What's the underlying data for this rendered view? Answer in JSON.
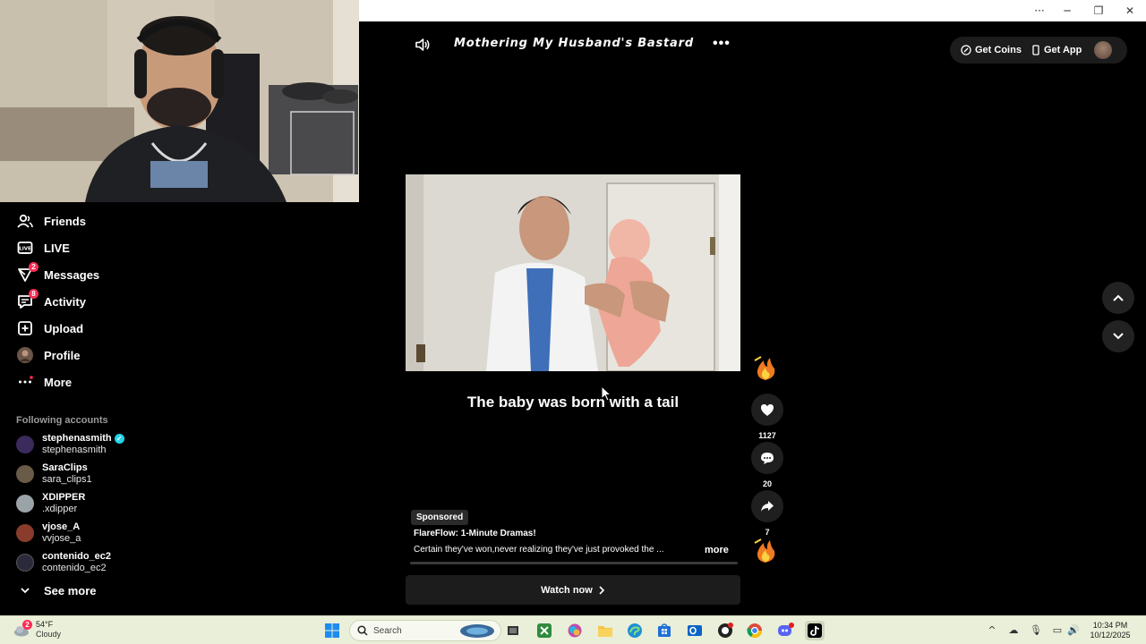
{
  "window": {
    "controls": [
      "···",
      "─",
      "❐",
      "✕"
    ]
  },
  "sidebar": {
    "items": [
      {
        "label": "Friends",
        "icon": "friends-icon"
      },
      {
        "label": "LIVE",
        "icon": "live-icon"
      },
      {
        "label": "Messages",
        "icon": "messages-icon",
        "badge": "2"
      },
      {
        "label": "Activity",
        "icon": "activity-icon",
        "badge": "8"
      },
      {
        "label": "Upload",
        "icon": "upload-icon"
      },
      {
        "label": "Profile",
        "icon": "profile-icon"
      },
      {
        "label": "More",
        "icon": "more-icon"
      }
    ],
    "following_title": "Following accounts",
    "accounts": [
      {
        "name": "stephenasmith",
        "handle": "stephenasmith",
        "verified": true,
        "color": "#3b2a5c"
      },
      {
        "name": "SaraClips",
        "handle": "sara_clips1",
        "verified": false,
        "color": "#6a5a48"
      },
      {
        "name": "XDIPPER",
        "handle": ".xdipper",
        "verified": false,
        "color": "#9aa3a8"
      },
      {
        "name": "vjose_A",
        "handle": "vvjose_a",
        "verified": false,
        "color": "#8a3c2c"
      },
      {
        "name": "contenido_ec2",
        "handle": "contenido_ec2",
        "verified": false,
        "color": "#2a2a3a"
      }
    ],
    "see_more": "See more"
  },
  "player": {
    "title": "Mothering My Husband's Bastard",
    "caption": "The baby was born with a tail",
    "actions": {
      "likes": "1127",
      "comments": "20",
      "shares": "7"
    }
  },
  "top_actions": {
    "coins": "Get Coins",
    "app": "Get App"
  },
  "ad": {
    "tag": "Sponsored",
    "title": "FlareFlow: 1-Minute Dramas!",
    "description": "Certain they've won,never realizing they've just provoked the ...",
    "more": "more",
    "watch": "Watch now"
  },
  "taskbar": {
    "weather_temp": "54°F",
    "weather_cond": "Cloudy",
    "weather_badge": "2",
    "search_placeholder": "Search",
    "time": "10:34 PM",
    "date": "10/12/2025"
  },
  "colors": {
    "accent": "#fe2c55",
    "verified": "#20d5ec",
    "taskbar": "#e9efd8"
  }
}
